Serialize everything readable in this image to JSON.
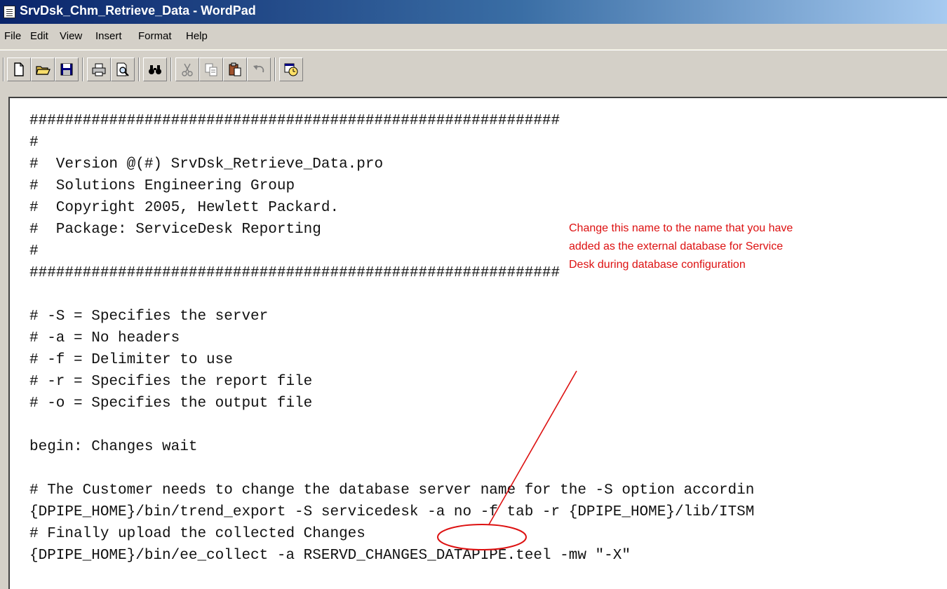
{
  "window": {
    "title": "SrvDsk_Chm_Retrieve_Data - WordPad"
  },
  "menu": [
    "File",
    "Edit",
    "View",
    "Insert",
    "Format",
    "Help"
  ],
  "toolbar": {
    "icons": [
      "new-document-icon",
      "open-folder-icon",
      "save-disk-icon",
      "print-icon",
      "print-preview-icon",
      "find-binoculars-icon",
      "cut-scissors-icon",
      "copy-icon",
      "paste-clipboard-icon",
      "undo-icon",
      "date-time-icon"
    ]
  },
  "document": {
    "lines": [
      "############################################################",
      "#",
      "#  Version @(#) SrvDsk_Retrieve_Data.pro",
      "#  Solutions Engineering Group",
      "#  Copyright 2005, Hewlett Packard.",
      "#  Package: ServiceDesk Reporting",
      "#",
      "############################################################",
      "",
      "# -S = Specifies the server",
      "# -a = No headers",
      "# -f = Delimiter to use",
      "# -r = Specifies the report file",
      "# -o = Specifies the output file",
      "",
      "begin: Changes wait",
      "",
      "# The Customer needs to change the database server name for the -S option accordin",
      "{DPIPE_HOME}/bin/trend_export -S servicedesk -a no -f tab -r {DPIPE_HOME}/lib/ITSM",
      "# Finally upload the collected Changes",
      "{DPIPE_HOME}/bin/ee_collect -a RSERVD_CHANGES_DATAPIPE.teel -mw \"-X\""
    ]
  },
  "annotation": {
    "lines": [
      "Change this name to the name that you have",
      "added as the external database for Service",
      "Desk during database configuration"
    ],
    "color": "#dd1111"
  }
}
